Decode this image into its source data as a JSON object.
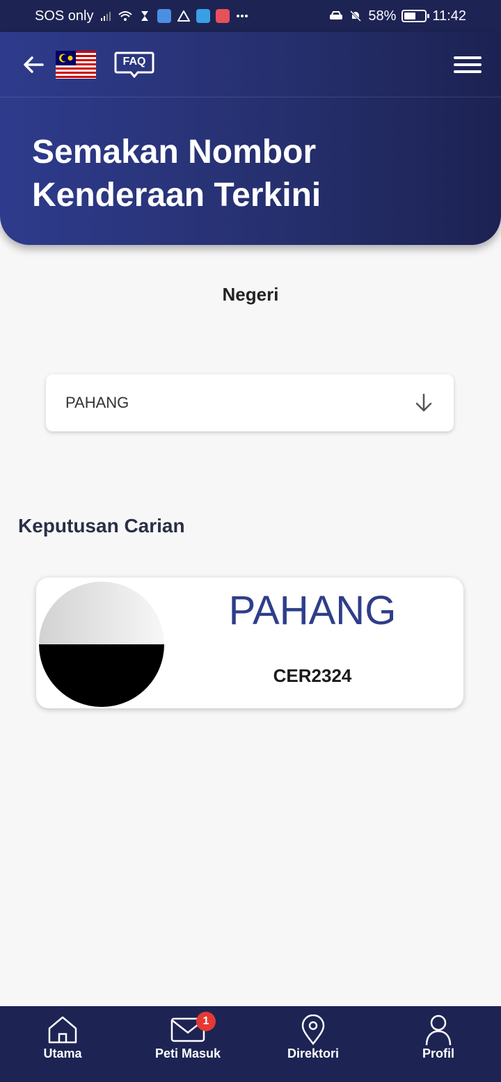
{
  "status_bar": {
    "carrier": "SOS only",
    "battery": "58%",
    "battery_level": 0.58,
    "time": "11:42"
  },
  "header": {
    "back_icon": "arrow-left-icon",
    "faq_label": "FAQ",
    "menu_icon": "hamburger-menu-icon",
    "title": "Semakan Nombor Kenderaan Terkini"
  },
  "form": {
    "state_label": "Negeri",
    "state_value": "PAHANG",
    "dropdown_icon": "arrow-down-icon"
  },
  "results": {
    "heading": "Keputusan Carian",
    "card": {
      "state": "PAHANG",
      "plate": "CER2324"
    }
  },
  "bottom_nav": {
    "items": [
      {
        "label": "Utama",
        "icon": "home-icon"
      },
      {
        "label": "Peti Masuk",
        "icon": "mail-icon",
        "badge": "1"
      },
      {
        "label": "Direktori",
        "icon": "location-pin-icon"
      },
      {
        "label": "Profil",
        "icon": "person-icon"
      }
    ]
  },
  "colors": {
    "primary": "#2e3b8c",
    "nav_bg": "#1d2453",
    "accent_text": "#2e3e8a",
    "badge": "#e53935"
  }
}
